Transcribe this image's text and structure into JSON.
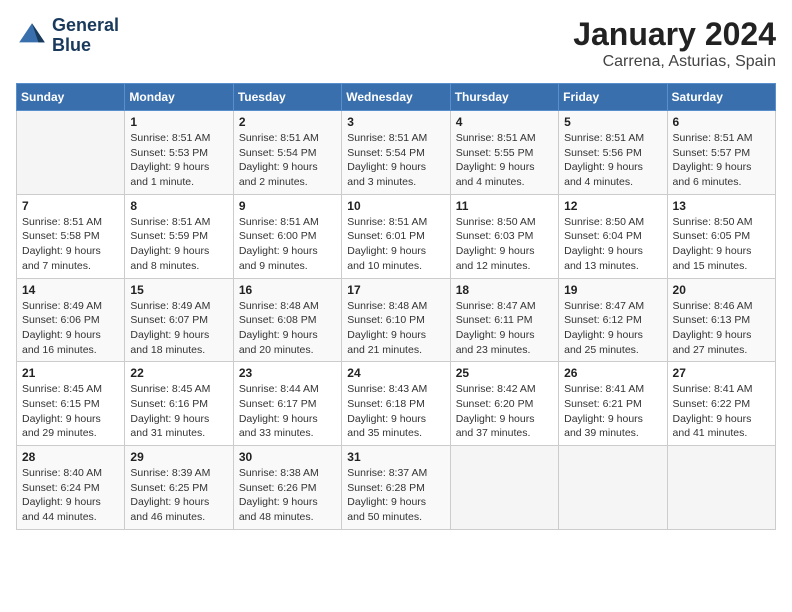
{
  "header": {
    "logo_line1": "General",
    "logo_line2": "Blue",
    "month": "January 2024",
    "location": "Carrena, Asturias, Spain"
  },
  "weekdays": [
    "Sunday",
    "Monday",
    "Tuesday",
    "Wednesday",
    "Thursday",
    "Friday",
    "Saturday"
  ],
  "weeks": [
    [
      {
        "day": "",
        "sunrise": "",
        "sunset": "",
        "daylight": ""
      },
      {
        "day": "1",
        "sunrise": "Sunrise: 8:51 AM",
        "sunset": "Sunset: 5:53 PM",
        "daylight": "Daylight: 9 hours and 1 minute."
      },
      {
        "day": "2",
        "sunrise": "Sunrise: 8:51 AM",
        "sunset": "Sunset: 5:54 PM",
        "daylight": "Daylight: 9 hours and 2 minutes."
      },
      {
        "day": "3",
        "sunrise": "Sunrise: 8:51 AM",
        "sunset": "Sunset: 5:54 PM",
        "daylight": "Daylight: 9 hours and 3 minutes."
      },
      {
        "day": "4",
        "sunrise": "Sunrise: 8:51 AM",
        "sunset": "Sunset: 5:55 PM",
        "daylight": "Daylight: 9 hours and 4 minutes."
      },
      {
        "day": "5",
        "sunrise": "Sunrise: 8:51 AM",
        "sunset": "Sunset: 5:56 PM",
        "daylight": "Daylight: 9 hours and 4 minutes."
      },
      {
        "day": "6",
        "sunrise": "Sunrise: 8:51 AM",
        "sunset": "Sunset: 5:57 PM",
        "daylight": "Daylight: 9 hours and 6 minutes."
      }
    ],
    [
      {
        "day": "7",
        "sunrise": "Sunrise: 8:51 AM",
        "sunset": "Sunset: 5:58 PM",
        "daylight": "Daylight: 9 hours and 7 minutes."
      },
      {
        "day": "8",
        "sunrise": "Sunrise: 8:51 AM",
        "sunset": "Sunset: 5:59 PM",
        "daylight": "Daylight: 9 hours and 8 minutes."
      },
      {
        "day": "9",
        "sunrise": "Sunrise: 8:51 AM",
        "sunset": "Sunset: 6:00 PM",
        "daylight": "Daylight: 9 hours and 9 minutes."
      },
      {
        "day": "10",
        "sunrise": "Sunrise: 8:51 AM",
        "sunset": "Sunset: 6:01 PM",
        "daylight": "Daylight: 9 hours and 10 minutes."
      },
      {
        "day": "11",
        "sunrise": "Sunrise: 8:50 AM",
        "sunset": "Sunset: 6:03 PM",
        "daylight": "Daylight: 9 hours and 12 minutes."
      },
      {
        "day": "12",
        "sunrise": "Sunrise: 8:50 AM",
        "sunset": "Sunset: 6:04 PM",
        "daylight": "Daylight: 9 hours and 13 minutes."
      },
      {
        "day": "13",
        "sunrise": "Sunrise: 8:50 AM",
        "sunset": "Sunset: 6:05 PM",
        "daylight": "Daylight: 9 hours and 15 minutes."
      }
    ],
    [
      {
        "day": "14",
        "sunrise": "Sunrise: 8:49 AM",
        "sunset": "Sunset: 6:06 PM",
        "daylight": "Daylight: 9 hours and 16 minutes."
      },
      {
        "day": "15",
        "sunrise": "Sunrise: 8:49 AM",
        "sunset": "Sunset: 6:07 PM",
        "daylight": "Daylight: 9 hours and 18 minutes."
      },
      {
        "day": "16",
        "sunrise": "Sunrise: 8:48 AM",
        "sunset": "Sunset: 6:08 PM",
        "daylight": "Daylight: 9 hours and 20 minutes."
      },
      {
        "day": "17",
        "sunrise": "Sunrise: 8:48 AM",
        "sunset": "Sunset: 6:10 PM",
        "daylight": "Daylight: 9 hours and 21 minutes."
      },
      {
        "day": "18",
        "sunrise": "Sunrise: 8:47 AM",
        "sunset": "Sunset: 6:11 PM",
        "daylight": "Daylight: 9 hours and 23 minutes."
      },
      {
        "day": "19",
        "sunrise": "Sunrise: 8:47 AM",
        "sunset": "Sunset: 6:12 PM",
        "daylight": "Daylight: 9 hours and 25 minutes."
      },
      {
        "day": "20",
        "sunrise": "Sunrise: 8:46 AM",
        "sunset": "Sunset: 6:13 PM",
        "daylight": "Daylight: 9 hours and 27 minutes."
      }
    ],
    [
      {
        "day": "21",
        "sunrise": "Sunrise: 8:45 AM",
        "sunset": "Sunset: 6:15 PM",
        "daylight": "Daylight: 9 hours and 29 minutes."
      },
      {
        "day": "22",
        "sunrise": "Sunrise: 8:45 AM",
        "sunset": "Sunset: 6:16 PM",
        "daylight": "Daylight: 9 hours and 31 minutes."
      },
      {
        "day": "23",
        "sunrise": "Sunrise: 8:44 AM",
        "sunset": "Sunset: 6:17 PM",
        "daylight": "Daylight: 9 hours and 33 minutes."
      },
      {
        "day": "24",
        "sunrise": "Sunrise: 8:43 AM",
        "sunset": "Sunset: 6:18 PM",
        "daylight": "Daylight: 9 hours and 35 minutes."
      },
      {
        "day": "25",
        "sunrise": "Sunrise: 8:42 AM",
        "sunset": "Sunset: 6:20 PM",
        "daylight": "Daylight: 9 hours and 37 minutes."
      },
      {
        "day": "26",
        "sunrise": "Sunrise: 8:41 AM",
        "sunset": "Sunset: 6:21 PM",
        "daylight": "Daylight: 9 hours and 39 minutes."
      },
      {
        "day": "27",
        "sunrise": "Sunrise: 8:41 AM",
        "sunset": "Sunset: 6:22 PM",
        "daylight": "Daylight: 9 hours and 41 minutes."
      }
    ],
    [
      {
        "day": "28",
        "sunrise": "Sunrise: 8:40 AM",
        "sunset": "Sunset: 6:24 PM",
        "daylight": "Daylight: 9 hours and 44 minutes."
      },
      {
        "day": "29",
        "sunrise": "Sunrise: 8:39 AM",
        "sunset": "Sunset: 6:25 PM",
        "daylight": "Daylight: 9 hours and 46 minutes."
      },
      {
        "day": "30",
        "sunrise": "Sunrise: 8:38 AM",
        "sunset": "Sunset: 6:26 PM",
        "daylight": "Daylight: 9 hours and 48 minutes."
      },
      {
        "day": "31",
        "sunrise": "Sunrise: 8:37 AM",
        "sunset": "Sunset: 6:28 PM",
        "daylight": "Daylight: 9 hours and 50 minutes."
      },
      {
        "day": "",
        "sunrise": "",
        "sunset": "",
        "daylight": ""
      },
      {
        "day": "",
        "sunrise": "",
        "sunset": "",
        "daylight": ""
      },
      {
        "day": "",
        "sunrise": "",
        "sunset": "",
        "daylight": ""
      }
    ]
  ]
}
